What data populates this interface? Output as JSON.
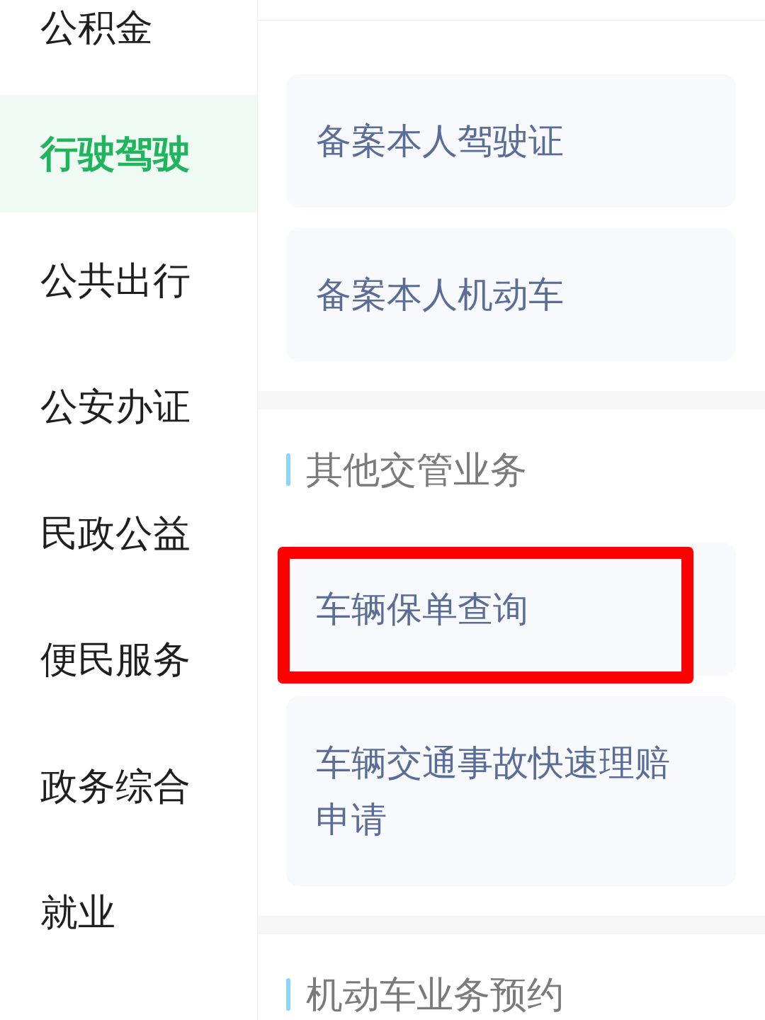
{
  "sidebar": {
    "items": [
      {
        "label": "公积金",
        "selected": false
      },
      {
        "label": "行驶驾驶",
        "selected": true
      },
      {
        "label": "公共出行",
        "selected": false
      },
      {
        "label": "公安办证",
        "selected": false
      },
      {
        "label": "民政公益",
        "selected": false
      },
      {
        "label": "便民服务",
        "selected": false
      },
      {
        "label": "政务综合",
        "selected": false
      },
      {
        "label": "就业",
        "selected": false
      }
    ]
  },
  "sections": [
    {
      "items": [
        {
          "label": "备案本人驾驶证",
          "highlighted": false
        },
        {
          "label": "备案本人机动车",
          "highlighted": false
        }
      ]
    },
    {
      "title": "其他交管业务",
      "items": [
        {
          "label": "车辆保单查询",
          "highlighted": true
        },
        {
          "label": "车辆交通事故快速理赔申请",
          "highlighted": false
        }
      ]
    },
    {
      "title": "机动车业务预约"
    }
  ]
}
